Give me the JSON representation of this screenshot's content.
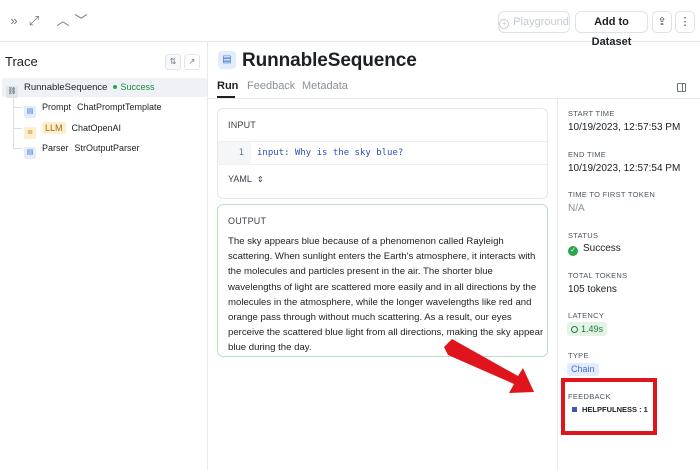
{
  "topbar": {
    "playground_label": "Playground",
    "add_dataset_label": "Add to Dataset"
  },
  "trace": {
    "title": "Trace",
    "root": {
      "name": "RunnableSequence",
      "status": "Success"
    },
    "children": [
      {
        "kind": "Prompt",
        "name": "ChatPromptTemplate",
        "icon": "prompt-icon"
      },
      {
        "kind": "LLM",
        "name": "ChatOpenAI",
        "icon": "llm-icon"
      },
      {
        "kind": "Parser",
        "name": "StrOutputParser",
        "icon": "parser-icon"
      }
    ]
  },
  "main": {
    "title": "RunnableSequence",
    "tabs": [
      "Run",
      "Feedback",
      "Metadata"
    ],
    "active_tab": "Run",
    "input": {
      "label": "INPUT",
      "line_number": "1",
      "code": "input: Why is the sky blue?",
      "format": "YAML"
    },
    "output": {
      "label": "OUTPUT",
      "text": "The sky appears blue because of a phenomenon called Rayleigh scattering. When sunlight enters the Earth's atmosphere, it interacts with the molecules and particles present in the air. The shorter blue wavelengths of light are scattered more easily and in all directions by the molecules in the atmosphere, while the longer wavelengths like red and orange pass through without much scattering. As a result, our eyes perceive the scattered blue light from all directions, making the sky appear blue during the day."
    }
  },
  "meta": {
    "start_time_label": "START TIME",
    "start_time": "10/19/2023, 12:57:53 PM",
    "end_time_label": "END TIME",
    "end_time": "10/19/2023, 12:57:54 PM",
    "ttft_label": "TIME TO FIRST TOKEN",
    "ttft": "N/A",
    "status_label": "STATUS",
    "status": "Success",
    "tokens_label": "TOTAL TOKENS",
    "tokens": "105 tokens",
    "latency_label": "LATENCY",
    "latency": "1.49s",
    "type_label": "TYPE",
    "type": "Chain",
    "feedback_label": "FEEDBACK",
    "feedback_item": "HELPFULNESS : 1"
  },
  "colors": {
    "annotation_red": "#e0141c",
    "success_green": "#2da44e",
    "accent_blue": "#3b6fd4"
  }
}
